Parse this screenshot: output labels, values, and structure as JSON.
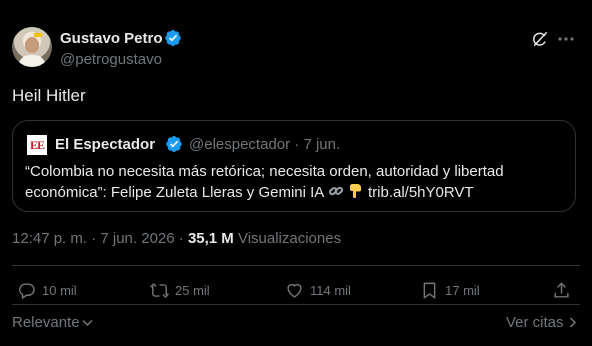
{
  "author": {
    "name": "Gustavo Petro",
    "handle": "@petrogustavo"
  },
  "tweet": {
    "text": "Heil Hitler"
  },
  "quote": {
    "logo_text": "EE",
    "name": "El Espectador",
    "handle_date": "@elespectador · 7 jun.",
    "text_main": "“Colombia no necesita más retórica; necesita orden, autoridad y libertad económica”: Felipe Zuleta Lleras y Gemini IA",
    "link": "trib.al/5hY0RVT"
  },
  "meta": {
    "time_date": "12:47 p. m. · 7 jun. 2026 · ",
    "views_count": "35,1 M",
    "views_label": "Visualizaciones"
  },
  "actions": {
    "replies": "10 mil",
    "reposts": "25 mil",
    "likes": "114 mil",
    "bookmarks": "17 mil"
  },
  "footer": {
    "sort_label": "Relevante",
    "quotes_label": "Ver citas"
  },
  "icons": {
    "verified": "verified-badge-icon",
    "grok": "grok-icon",
    "more": "more-icon",
    "reply": "reply-icon",
    "repost": "repost-icon",
    "like": "heart-icon",
    "bookmark": "bookmark-icon",
    "share": "share-icon"
  },
  "colors": {
    "background": "#000000",
    "text_primary": "#e7e9ea",
    "text_secondary": "#71767b",
    "border": "#2f3336",
    "verified": "#1d9bf0"
  }
}
